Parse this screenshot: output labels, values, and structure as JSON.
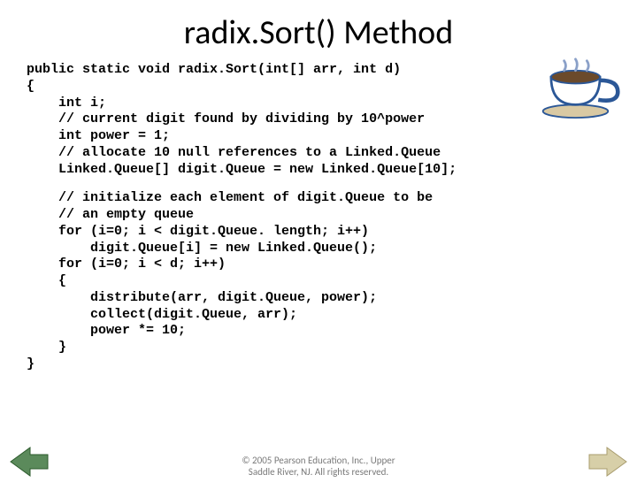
{
  "title": "radix.Sort() Method",
  "code": {
    "block1": "public static void radix.Sort(int[] arr, int d)\n{\n    int i;\n    // current digit found by dividing by 10^power\n    int power = 1;\n    // allocate 10 null references to a Linked.Queue\n    Linked.Queue[] digit.Queue = new Linked.Queue[10];",
    "block2": "    // initialize each element of digit.Queue to be\n    // an empty queue\n    for (i=0; i < digit.Queue. length; i++)\n        digit.Queue[i] = new Linked.Queue();\n    for (i=0; i < d; i++)\n    {\n        distribute(arr, digit.Queue, power);\n        collect(digit.Queue, arr);\n        power *= 10;\n    }\n}"
  },
  "footer": {
    "line1": "© 2005 Pearson Education, Inc., Upper",
    "line2": "Saddle River, NJ. All rights reserved."
  },
  "icons": {
    "teacup": "teacup-icon",
    "prev": "prev-arrow-icon",
    "next": "next-arrow-icon"
  }
}
